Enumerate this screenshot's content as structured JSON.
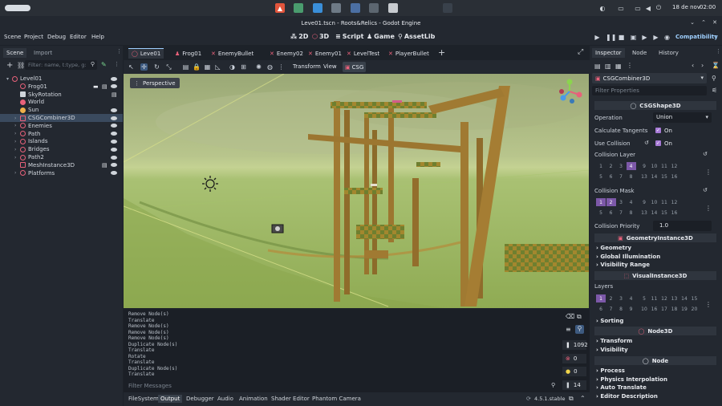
{
  "os": {
    "date": "18 de nov",
    "time": "02:00"
  },
  "window": {
    "title": "Leve01.tscn - Roots&Relics - Godot Engine"
  },
  "menu": {
    "items": [
      "Scene",
      "Project",
      "Debug",
      "Editor",
      "Help"
    ],
    "workspaces": [
      "2D",
      "3D",
      "Script",
      "Game",
      "AssetLib"
    ],
    "renderer": "Compatibility"
  },
  "scene_panel": {
    "tabs": [
      "Scene",
      "Import"
    ],
    "filter_placeholder": "Filter: name, t:type, g:gr",
    "nodes": [
      {
        "label": "Level01",
        "depth": 0
      },
      {
        "label": "Frog01",
        "depth": 1
      },
      {
        "label": "SkyRotation",
        "depth": 1
      },
      {
        "label": "World",
        "depth": 1
      },
      {
        "label": "Sun",
        "depth": 1
      },
      {
        "label": "CSGCombiner3D",
        "depth": 1
      },
      {
        "label": "Enemies",
        "depth": 1
      },
      {
        "label": "Path",
        "depth": 1
      },
      {
        "label": "Islands",
        "depth": 1
      },
      {
        "label": "Bridges",
        "depth": 1
      },
      {
        "label": "Path2",
        "depth": 1
      },
      {
        "label": "MeshInstance3D",
        "depth": 1
      },
      {
        "label": "Platforms",
        "depth": 1
      }
    ]
  },
  "editor_tabs": [
    "Leve01",
    "Frog01",
    "EnemyBullet",
    "Enemy02",
    "Enemy01",
    "LevelTest",
    "PlayerBullet"
  ],
  "viewport_toolbar": {
    "transform": "Transform",
    "view": "View",
    "csg": "CSG"
  },
  "viewport": {
    "perspective": "Perspective"
  },
  "output": {
    "lines": [
      "Remove Node(s)",
      "Translate",
      "Remove Node(s)",
      "Remove Node(s)",
      "Remove Node(s)",
      "Duplicate Node(s)",
      "Translate",
      "Rotate",
      "Translate",
      "Duplicate Node(s)",
      "Translate"
    ],
    "filter_placeholder": "Filter Messages",
    "counts": [
      "1092",
      "0",
      "0",
      "14"
    ]
  },
  "bottom_tabs": [
    "FileSystem",
    "Output",
    "Debugger",
    "Audio",
    "Animation",
    "Shader Editor",
    "Phantom Camera"
  ],
  "version": "4.5.1.stable",
  "inspector": {
    "tabs": [
      "Inspector",
      "Node",
      "History"
    ],
    "selected_node": "CSGCombiner3D",
    "filter_placeholder": "Filter Properties",
    "class_csg": "CSGShape3D",
    "operation_label": "Operation",
    "operation_value": "Union",
    "calc_tangents_label": "Calculate Tangents",
    "calc_tangents_value": "On",
    "use_collision_label": "Use Collision",
    "use_collision_value": "On",
    "collision_layer_label": "Collision Layer",
    "collision_mask_label": "Collision Mask",
    "collision_priority_label": "Collision Priority",
    "collision_priority_value": "1.0",
    "class_geometry": "GeometryInstance3D",
    "geometry_groups": [
      "Geometry",
      "Global Illumination",
      "Visibility Range"
    ],
    "class_visual": "VisualInstance3D",
    "layers_label": "Layers",
    "sorting": "Sorting",
    "class_node3d": "Node3D",
    "node3d_groups": [
      "Transform",
      "Visibility"
    ],
    "class_node": "Node",
    "node_groups": [
      "Process",
      "Physics Interpolation",
      "Auto Translate",
      "Editor Description"
    ],
    "layer_bits_row1": [
      "1",
      "2",
      "3",
      "4",
      "9",
      "10",
      "11",
      "12"
    ],
    "layer_bits_row2": [
      "5",
      "6",
      "7",
      "8",
      "13",
      "14",
      "15",
      "16"
    ],
    "vlayer_bits_row1": [
      "1",
      "2",
      "3",
      "4",
      "5",
      "11",
      "12",
      "13",
      "14",
      "15"
    ],
    "vlayer_bits_row2": [
      "6",
      "7",
      "8",
      "9",
      "10",
      "16",
      "17",
      "18",
      "19",
      "20"
    ]
  }
}
